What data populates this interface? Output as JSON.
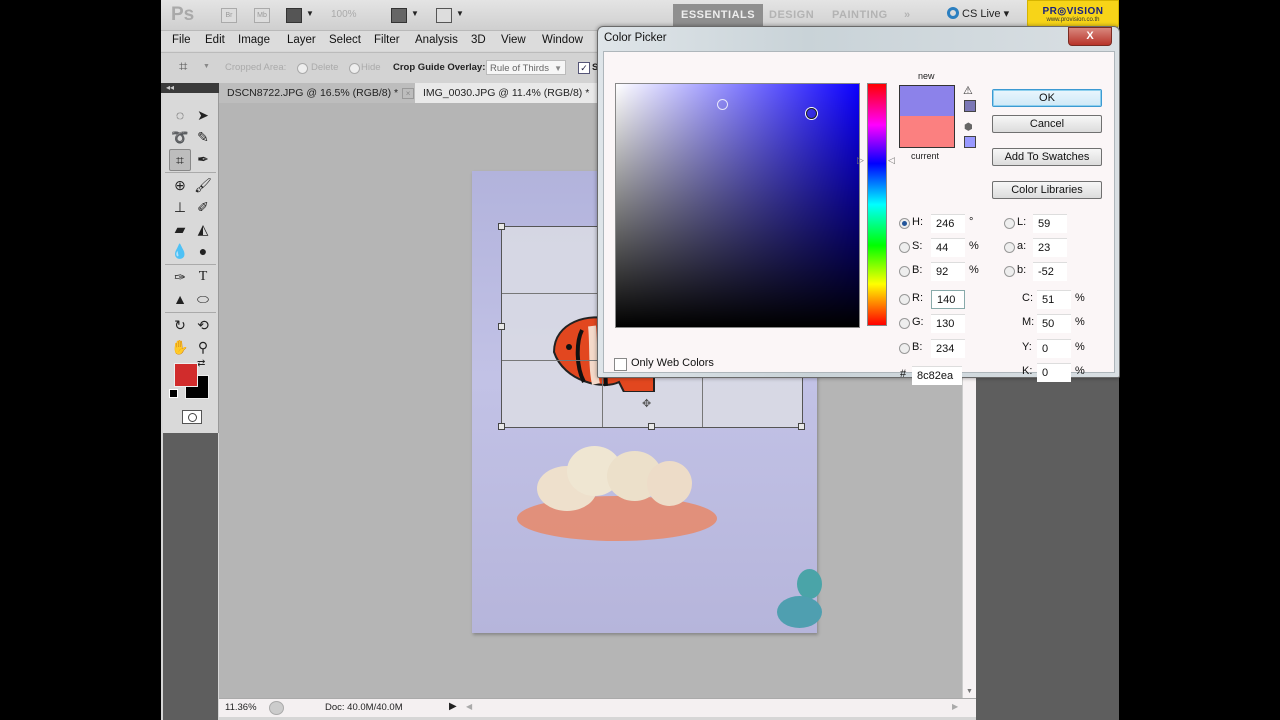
{
  "appbar": {
    "logo": "Ps",
    "icon_br": "Br",
    "icon_mb": "Mb",
    "zoom_level": "100%",
    "workspaces": [
      "ESSENTIALS",
      "DESIGN",
      "PAINTING",
      "»"
    ],
    "active_workspace": "ESSENTIALS",
    "cs_live": "CS Live ▾",
    "watermark_brand": "PR◎VISION",
    "watermark_url": "www.provision.co.th"
  },
  "menu": [
    "File",
    "Edit",
    "Image",
    "Layer",
    "Select",
    "Filter",
    "Analysis",
    "3D",
    "View",
    "Window"
  ],
  "options": {
    "cropped_area_label": "Cropped Area:",
    "delete_label": "Delete",
    "hide_label": "Hide",
    "overlay_label": "Crop Guide Overlay:",
    "overlay_value": "Rule of Thirds",
    "shield_checked": true,
    "shield_label": "S"
  },
  "tools": {
    "collapse": "◂◂",
    "foreground_color": "#d12c2c",
    "background_color": "#000000"
  },
  "tabs": [
    {
      "label": "DSCN8722.JPG @ 16.5% (RGB/8) *",
      "active": false
    },
    {
      "label": "IMG_0030.JPG @ 11.4% (RGB/8) *",
      "active": true
    }
  ],
  "status": {
    "zoom": "11.36%",
    "doc": "Doc: 40.0M/40.0M"
  },
  "color_picker": {
    "title": "Color Picker",
    "close": "X",
    "new_label": "new",
    "current_label": "current",
    "new_color": "#8c82ea",
    "current_color": "#fb8080",
    "buttons": {
      "ok": "OK",
      "cancel": "Cancel",
      "add_to_swatches": "Add To Swatches",
      "color_libraries": "Color Libraries"
    },
    "hsb": [
      {
        "label": "H:",
        "value": "246",
        "unit": "°",
        "selected": true
      },
      {
        "label": "S:",
        "value": "44",
        "unit": "%",
        "selected": false
      },
      {
        "label": "B:",
        "value": "92",
        "unit": "%",
        "selected": false
      }
    ],
    "rgb": [
      {
        "label": "R:",
        "value": "140",
        "selected": false
      },
      {
        "label": "G:",
        "value": "130",
        "selected": false
      },
      {
        "label": "B:",
        "value": "234",
        "selected": false
      }
    ],
    "lab": [
      {
        "label": "L:",
        "value": "59"
      },
      {
        "label": "a:",
        "value": "23"
      },
      {
        "label": "b:",
        "value": "-52"
      }
    ],
    "cmyk": [
      {
        "label": "C:",
        "value": "51",
        "unit": "%"
      },
      {
        "label": "M:",
        "value": "50",
        "unit": "%"
      },
      {
        "label": "Y:",
        "value": "0",
        "unit": "%"
      },
      {
        "label": "K:",
        "value": "0",
        "unit": "%"
      }
    ],
    "hex_label": "#",
    "hex": "8c82ea",
    "only_web_colors_label": "Only Web Colors",
    "only_web_colors": false
  }
}
